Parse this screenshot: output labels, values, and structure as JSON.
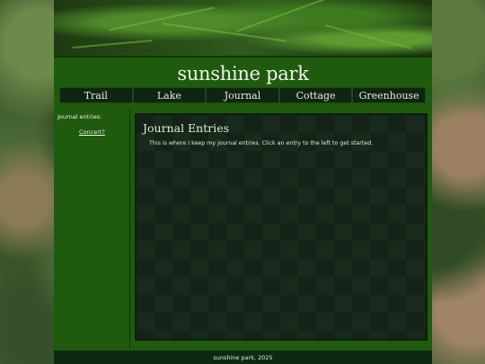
{
  "site": {
    "title": "sunshine park"
  },
  "nav": {
    "items": [
      {
        "label": "Trail"
      },
      {
        "label": "Lake"
      },
      {
        "label": "Journal"
      },
      {
        "label": "Cottage"
      },
      {
        "label": "Greenhouse"
      }
    ]
  },
  "sidebar": {
    "heading": "Journal entries:",
    "entries": [
      {
        "label": "Concert?"
      }
    ]
  },
  "main": {
    "title": "Journal Entries",
    "text": "This is where I keep my journal entries. Click an entry to the left to get started."
  },
  "footer": {
    "text": "sunshine park, 2025"
  },
  "colors": {
    "header_green": "#1f5a0e",
    "nav_dark": "#0f2512",
    "panel_dark": "#142218"
  }
}
